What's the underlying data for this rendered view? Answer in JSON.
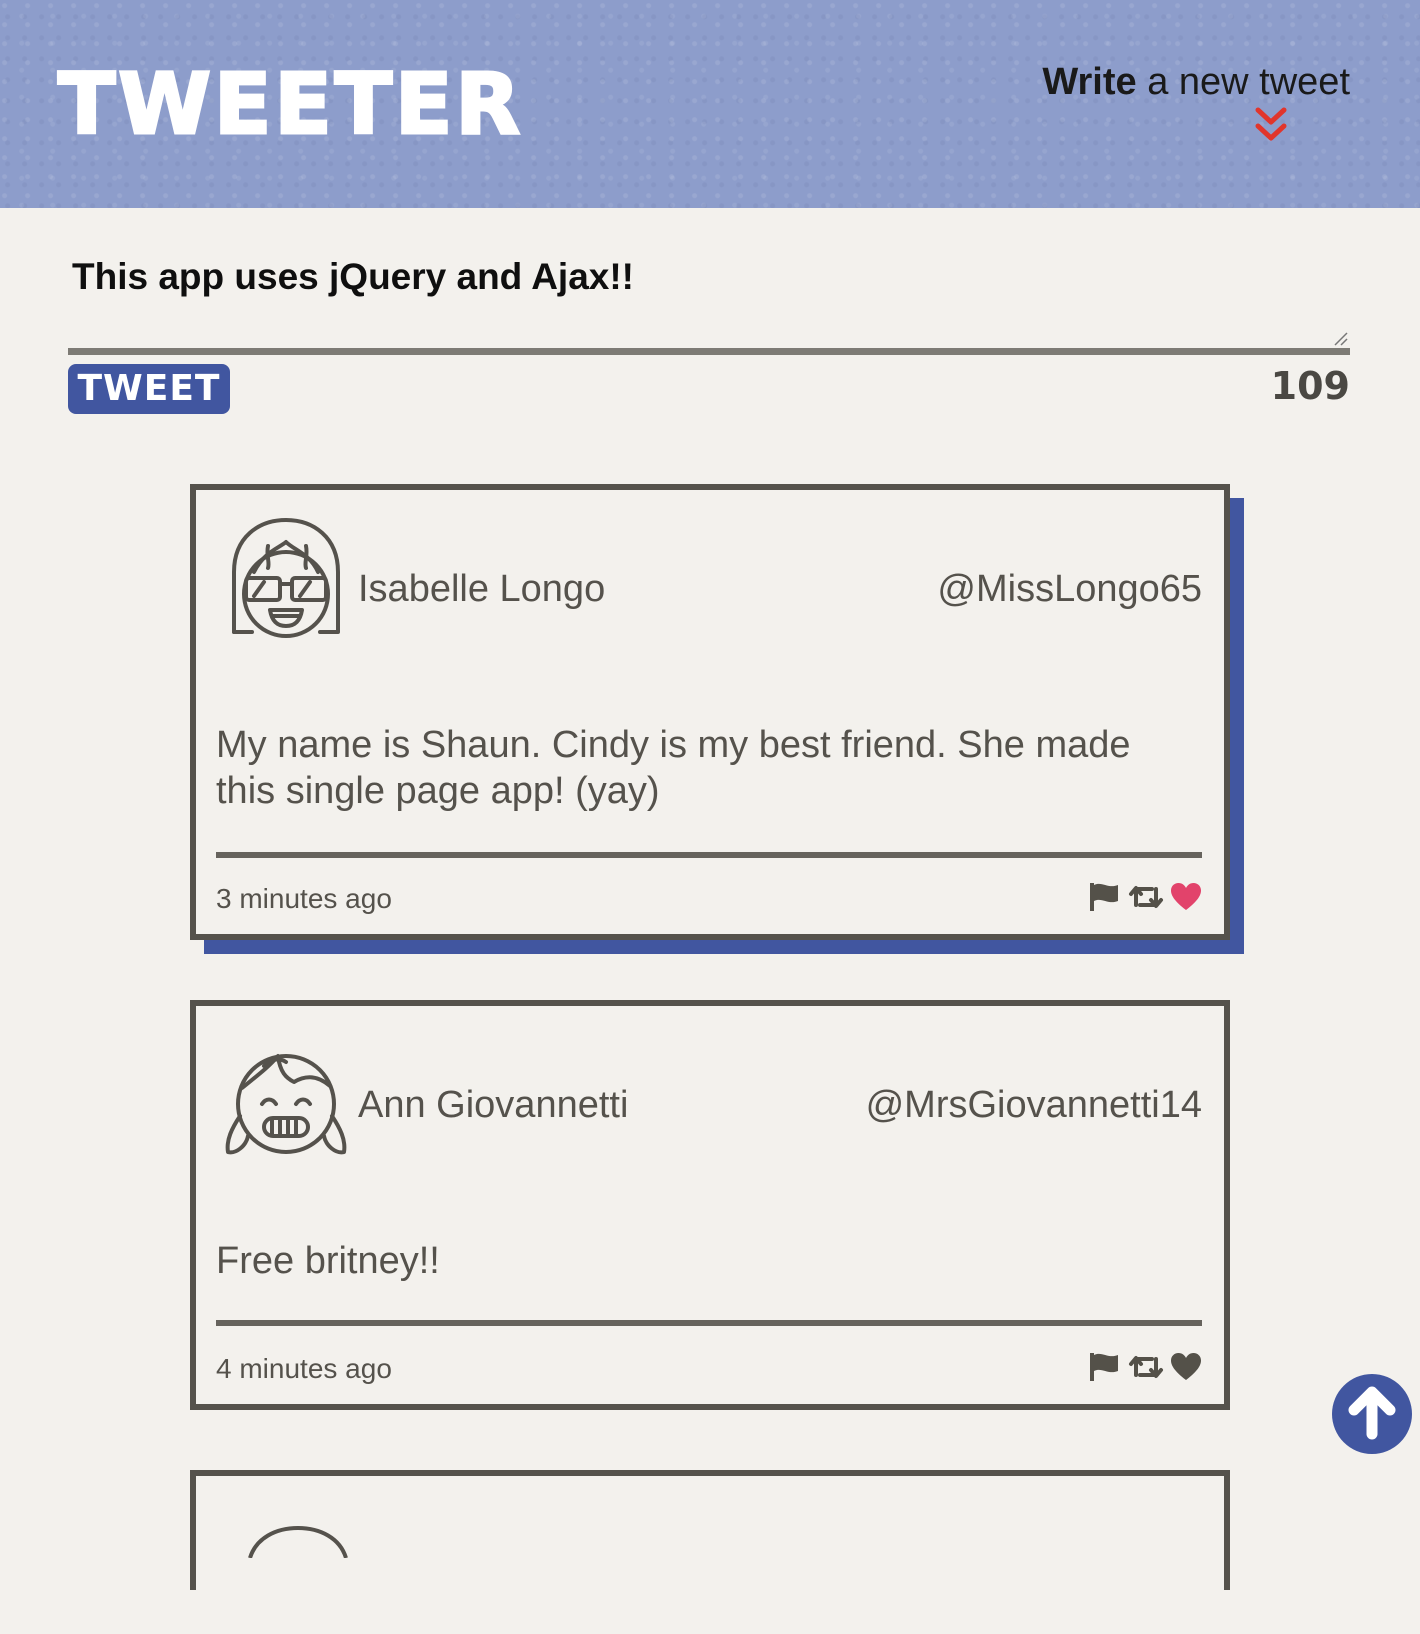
{
  "header": {
    "logo": "TWEETER",
    "compose_bold": "Write",
    "compose_rest": " a new tweet",
    "chevron_icon": "double-chevron-down-icon",
    "chevron_color": "#e1352c",
    "background_color": "#8d9dcb"
  },
  "compose": {
    "text": "This app uses jQuery and Ajax!!",
    "button_label": "TWEET",
    "char_counter": "109",
    "button_color": "#4156a0"
  },
  "tweets": [
    {
      "name": "Isabelle Longo",
      "handle": "@MissLongo65",
      "content": "My name is Shaun. Cindy is my best friend. She made this single page app! (yay)",
      "timestamp": "3 minutes ago",
      "liked": true,
      "like_color": "#e2436b"
    },
    {
      "name": "Ann Giovannetti",
      "handle": "@MrsGiovannetti14",
      "content": "Free britney!!",
      "timestamp": "4 minutes ago",
      "liked": false,
      "like_color": "#545149"
    },
    {
      "name": "",
      "handle": "",
      "content": "",
      "timestamp": ""
    }
  ],
  "icons": {
    "flag": "flag-icon",
    "retweet": "retweet-icon",
    "like": "heart-icon",
    "scroll_top": "arrow-up-icon"
  }
}
